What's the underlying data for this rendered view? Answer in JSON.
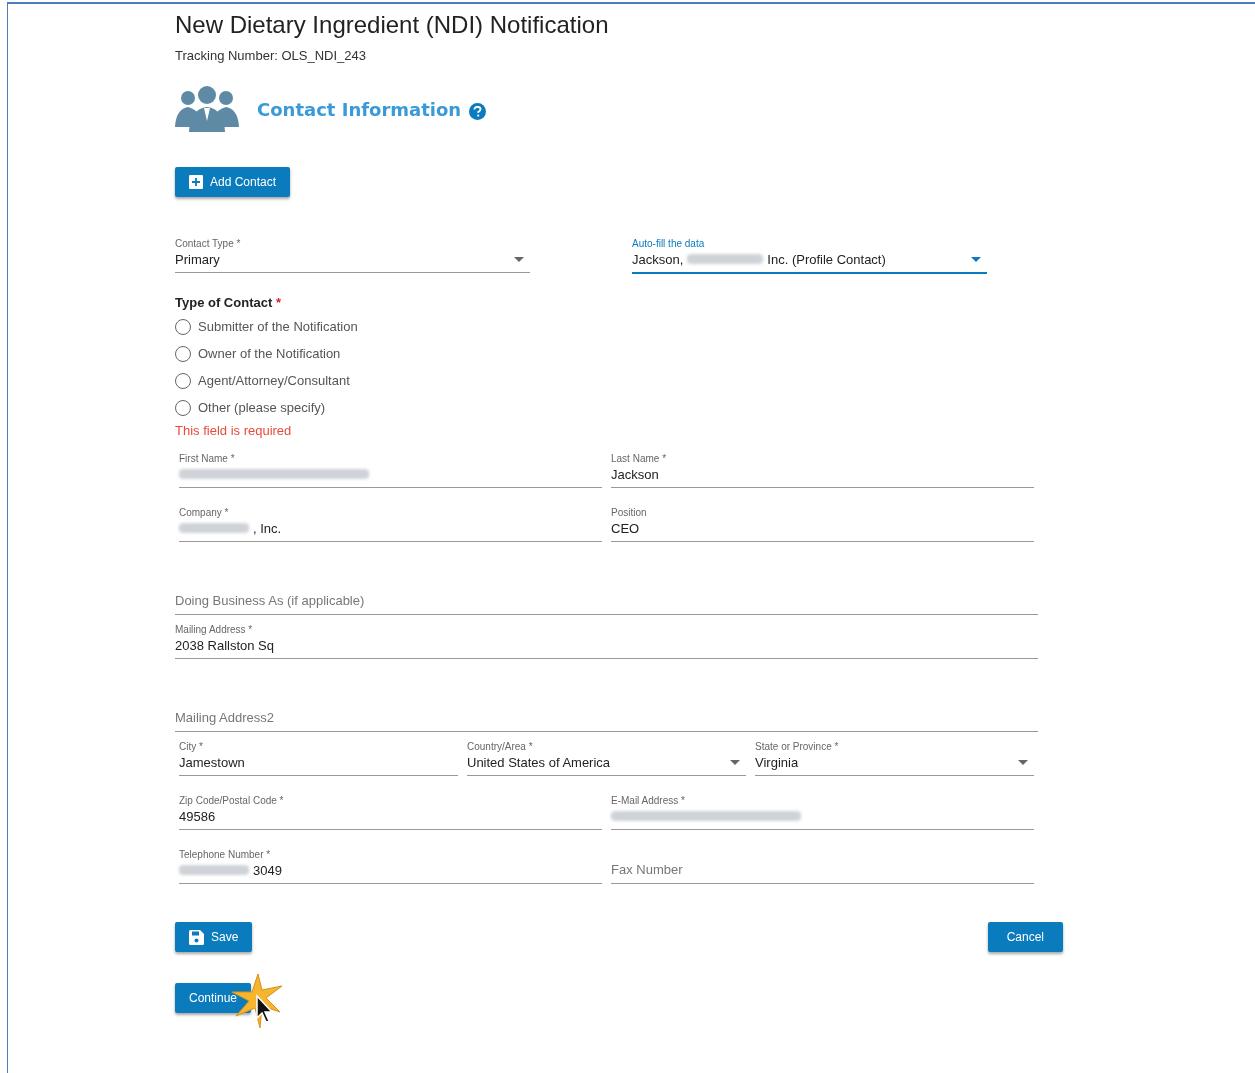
{
  "header": {
    "title": "New Dietary Ingredient (NDI) Notification",
    "tracking_number": "Tracking Number: OLS_NDI_243"
  },
  "section": {
    "title": "Contact Information"
  },
  "add_button": "Add Contact",
  "selects": [
    {
      "label": "Contact Type *",
      "focused": false,
      "value": [
        {
          "kind": "text",
          "text": "Primary"
        }
      ]
    },
    {
      "label": "Auto-fill the data",
      "focused": true,
      "value": [
        {
          "kind": "text",
          "text": "Jackson,"
        },
        {
          "kind": "redacted"
        },
        {
          "kind": "text",
          "text": "Inc. (Profile Contact)"
        }
      ]
    }
  ],
  "type_of_contact": {
    "label": "Type of Contact",
    "required_mark": "*",
    "options": [
      {
        "label": "Submitter of the Notification",
        "selected": false
      },
      {
        "label": "Owner of the Notification",
        "selected": false
      },
      {
        "label": "Agent/Attorney/Consultant",
        "selected": false
      },
      {
        "label": "Other (please specify)",
        "selected": false
      }
    ],
    "error": "This field is required"
  },
  "field_rows": [
    [
      {
        "kind": "text",
        "label": "First Name *",
        "value": [
          {
            "kind": "redacted"
          }
        ]
      },
      {
        "kind": "text",
        "label": "Last Name *",
        "value": [
          {
            "kind": "text",
            "text": "Jackson"
          }
        ]
      }
    ],
    [
      {
        "kind": "text",
        "label": "Company *",
        "value": [
          {
            "kind": "redacted"
          },
          {
            "kind": "text",
            "text": ", Inc."
          }
        ]
      },
      {
        "kind": "text",
        "label": "Position",
        "value": [
          {
            "kind": "text",
            "text": "CEO"
          }
        ]
      }
    ],
    [
      {
        "kind": "empty",
        "placeholder": "Doing Business As (if applicable)"
      }
    ],
    [
      {
        "kind": "text",
        "label": "Mailing Address *",
        "value": [
          {
            "kind": "text",
            "text": "2038 Rallston Sq"
          }
        ]
      }
    ],
    [
      {
        "kind": "empty",
        "placeholder": "Mailing Address2"
      }
    ],
    [
      {
        "kind": "text",
        "label": "City *",
        "value": [
          {
            "kind": "text",
            "text": "Jamestown"
          }
        ]
      },
      {
        "kind": "select",
        "label": "Country/Area *",
        "value": [
          {
            "kind": "text",
            "text": "United States of America"
          }
        ]
      },
      {
        "kind": "select",
        "label": "State or Province *",
        "value": [
          {
            "kind": "text",
            "text": "Virginia"
          }
        ]
      }
    ],
    [
      {
        "kind": "text",
        "label": "Zip Code/Postal Code *",
        "value": [
          {
            "kind": "text",
            "text": "49586"
          }
        ]
      },
      {
        "kind": "text",
        "label": "E-Mail Address *",
        "value": [
          {
            "kind": "redacted"
          }
        ]
      }
    ],
    [
      {
        "kind": "text",
        "label": "Telephone Number *",
        "value": [
          {
            "kind": "redacted"
          },
          {
            "kind": "text",
            "text": "3049"
          }
        ]
      },
      {
        "kind": "empty",
        "placeholder": "Fax Number"
      }
    ]
  ],
  "buttons": {
    "save": "Save",
    "cancel": "Cancel",
    "continue": "Continue"
  }
}
